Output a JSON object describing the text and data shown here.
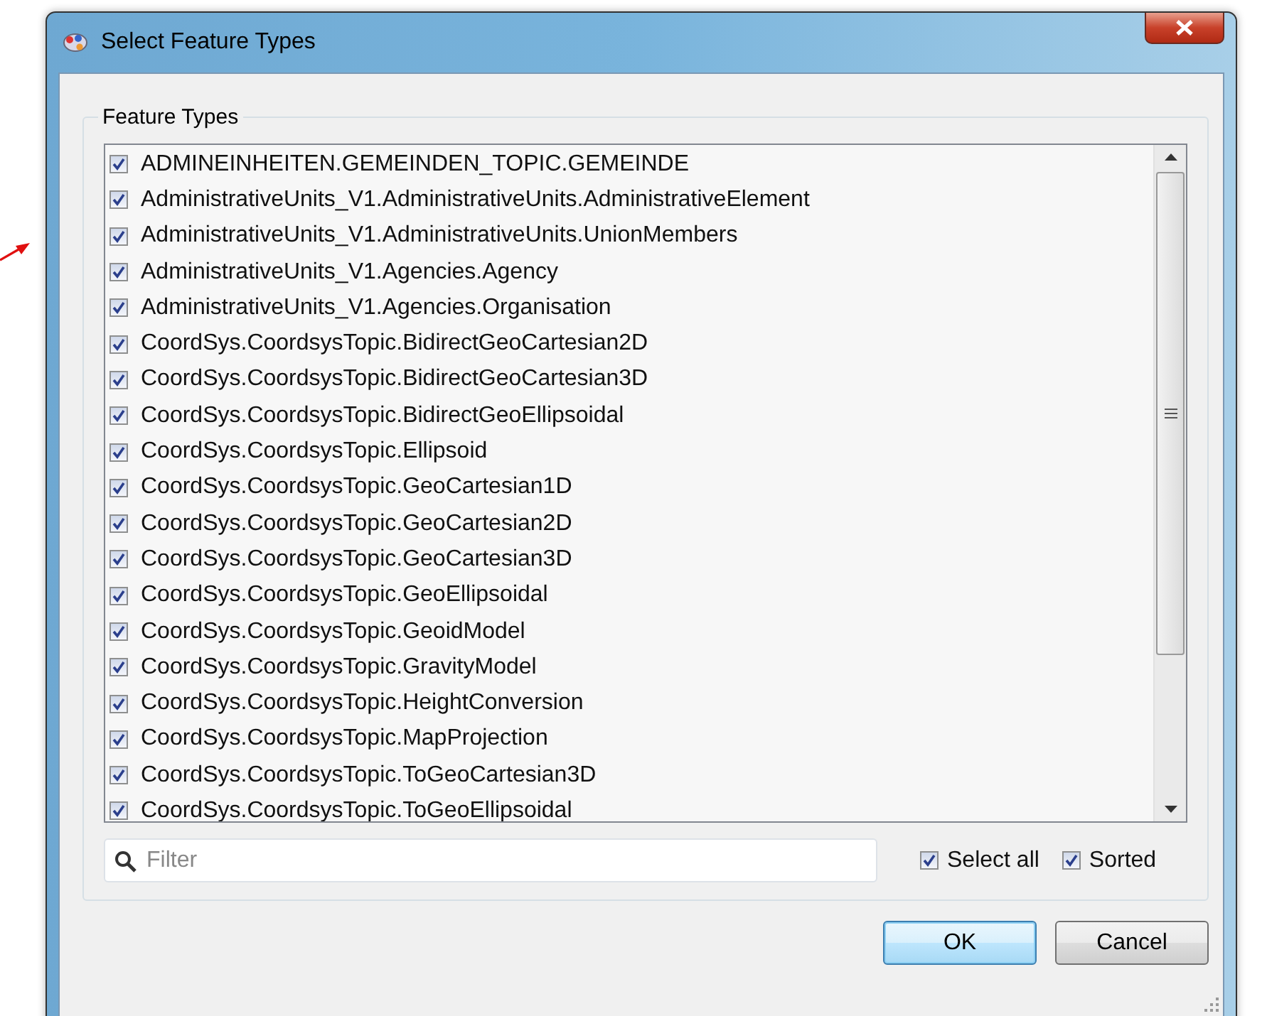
{
  "window": {
    "title": "Select Feature Types"
  },
  "group": {
    "title": "Feature Types"
  },
  "items": [
    {
      "label": "ADMINEINHEITEN.GEMEINDEN_TOPIC.GEMEINDE",
      "checked": true
    },
    {
      "label": "AdministrativeUnits_V1.AdministrativeUnits.AdministrativeElement",
      "checked": true
    },
    {
      "label": "AdministrativeUnits_V1.AdministrativeUnits.UnionMembers",
      "checked": true
    },
    {
      "label": "AdministrativeUnits_V1.Agencies.Agency",
      "checked": true
    },
    {
      "label": "AdministrativeUnits_V1.Agencies.Organisation",
      "checked": true
    },
    {
      "label": "CoordSys.CoordsysTopic.BidirectGeoCartesian2D",
      "checked": true
    },
    {
      "label": "CoordSys.CoordsysTopic.BidirectGeoCartesian3D",
      "checked": true
    },
    {
      "label": "CoordSys.CoordsysTopic.BidirectGeoEllipsoidal",
      "checked": true
    },
    {
      "label": "CoordSys.CoordsysTopic.Ellipsoid",
      "checked": true
    },
    {
      "label": "CoordSys.CoordsysTopic.GeoCartesian1D",
      "checked": true
    },
    {
      "label": "CoordSys.CoordsysTopic.GeoCartesian2D",
      "checked": true
    },
    {
      "label": "CoordSys.CoordsysTopic.GeoCartesian3D",
      "checked": true
    },
    {
      "label": "CoordSys.CoordsysTopic.GeoEllipsoidal",
      "checked": true
    },
    {
      "label": "CoordSys.CoordsysTopic.GeoidModel",
      "checked": true
    },
    {
      "label": "CoordSys.CoordsysTopic.GravityModel",
      "checked": true
    },
    {
      "label": "CoordSys.CoordsysTopic.HeightConversion",
      "checked": true
    },
    {
      "label": "CoordSys.CoordsysTopic.MapProjection",
      "checked": true
    },
    {
      "label": "CoordSys.CoordsysTopic.ToGeoCartesian3D",
      "checked": true
    },
    {
      "label": "CoordSys.CoordsysTopic.ToGeoEllipsoidal",
      "checked": true
    }
  ],
  "filter": {
    "placeholder": "Filter"
  },
  "options": [
    {
      "label": "Select all",
      "checked": true
    },
    {
      "label": "Sorted",
      "checked": true
    }
  ],
  "buttons": [
    {
      "label": "OK",
      "kind": "default"
    },
    {
      "label": "Cancel",
      "kind": "normal"
    }
  ]
}
